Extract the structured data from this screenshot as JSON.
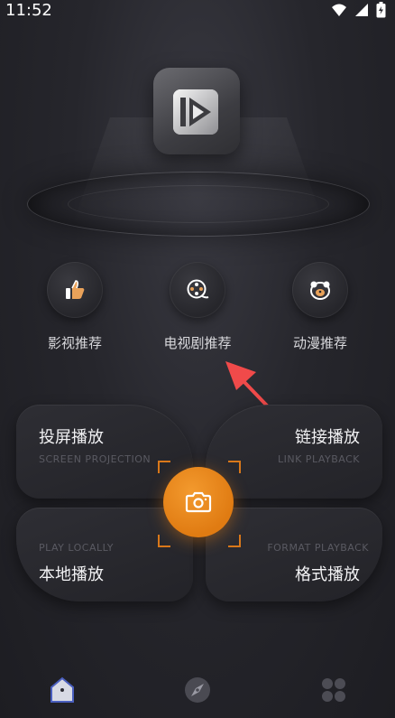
{
  "status_bar": {
    "time": "11:52"
  },
  "categories": [
    {
      "label": "影视推荐",
      "icon": "thumbs-up-icon"
    },
    {
      "label": "电视剧推荐",
      "icon": "film-reel-icon"
    },
    {
      "label": "动漫推荐",
      "icon": "bear-face-icon"
    }
  ],
  "panels": {
    "screen_projection": {
      "title": "投屏播放",
      "subtitle": "SCREEN PROJECTION"
    },
    "link_playback": {
      "title": "链接播放",
      "subtitle": "LINK PLAYBACK"
    },
    "play_locally": {
      "title": "本地播放",
      "subtitle": "PLAY LOCALLY"
    },
    "format_playback": {
      "title": "格式播放",
      "subtitle": "FORMAT PLAYBACK"
    }
  },
  "bottom_nav": [
    {
      "icon": "home-icon",
      "active": true
    },
    {
      "icon": "compass-icon",
      "active": false
    },
    {
      "icon": "apps-grid-icon",
      "active": false
    }
  ],
  "colors": {
    "accent": "#e07b12",
    "background": "#26262c",
    "arrow": "#f04a4a"
  }
}
